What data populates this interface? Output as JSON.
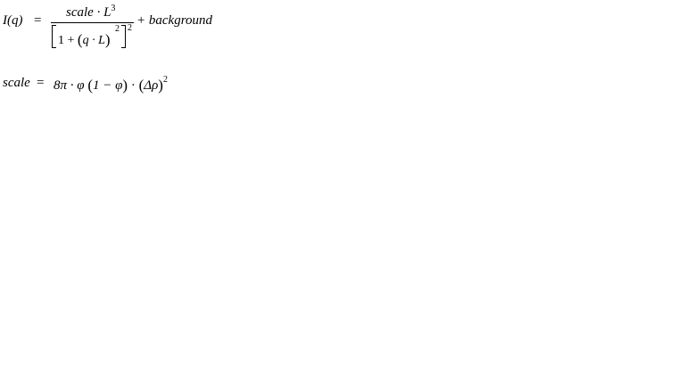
{
  "equation_1": {
    "lhs": "I(q)",
    "equals": "=",
    "numerator": "scale · L",
    "numerator_exponent": "3",
    "denominator_one_plus": "1 +",
    "denominator_open_paren": "(",
    "denominator_inner": "q · L",
    "denominator_close_paren": ")",
    "inner_exponent": "2",
    "outer_exponent": "2",
    "tail": "+ background"
  },
  "equation_2": {
    "lhs": "scale",
    "equals": "=",
    "rhs_prefix": "8π · φ ",
    "rhs_open_paren_1": "(",
    "rhs_mid": "1 − φ",
    "rhs_close_paren_1": ")",
    "rhs_dot": " · ",
    "rhs_open_paren_2": "(",
    "rhs_delta_rho": "Δρ",
    "rhs_close_paren_2": ")",
    "rhs_exponent": "2"
  }
}
